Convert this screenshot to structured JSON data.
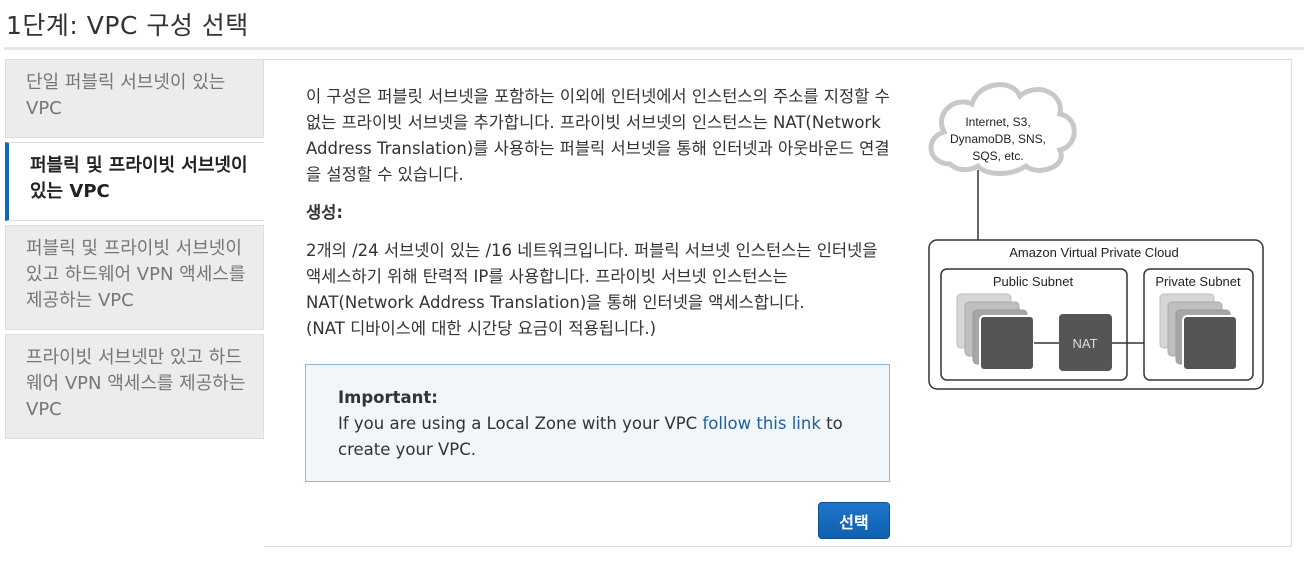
{
  "page": {
    "title": "1단계: VPC 구성 선택"
  },
  "sidebar": {
    "items": [
      {
        "label": "단일 퍼블릭 서브넷이 있는 VPC",
        "active": false
      },
      {
        "label": "퍼블릭 및 프라이빗 서브넷이 있는 VPC",
        "active": true
      },
      {
        "label": "퍼블릭 및 프라이빗 서브넷이 있고 하드웨어 VPN 액세스를 제공하는 VPC",
        "active": false
      },
      {
        "label": "프라이빗 서브넷만 있고 하드웨어 VPN 액세스를 제공하는 VPC",
        "active": false
      }
    ]
  },
  "main": {
    "description": "이 구성은 퍼블릿 서브넷을 포함하는 이외에 인터넷에서 인스턴스의 주소를 지정할 수 없는 프라이빗 서브넷을 추가합니다. 프라이빗 서브넷의 인스턴스는 NAT(Network Address Translation)를 사용하는 퍼블릭 서브넷을 통해 인터넷과 아웃바운드 연결을 설정할 수 있습니다.",
    "create_label": "생성:",
    "create_text": "2개의 /24 서브넷이 있는 /16 네트워크입니다. 퍼블릭 서브넷 인스턴스는 인터넷을 액세스하기 위해 탄력적 IP를 사용합니다. 프라이빗 서브넷 인스턴스는 NAT(Network Address Translation)을 통해 인터넷을 액세스합니다.",
    "create_note": "(NAT 디바이스에 대한 시간당 요금이 적용됩니다.)",
    "important": {
      "title": "Important:",
      "text_before": "If you are using a Local Zone with your VPC ",
      "link": "follow this link",
      "text_after": " to create your VPC."
    },
    "select_button": "선택"
  },
  "diagram": {
    "cloud_line1": "Internet, S3,",
    "cloud_line2": "DynamoDB, SNS,",
    "cloud_line3": "SQS, etc.",
    "vpc_label": "Amazon Virtual Private Cloud",
    "public_subnet": "Public Subnet",
    "private_subnet": "Private Subnet",
    "nat_label": "NAT"
  }
}
